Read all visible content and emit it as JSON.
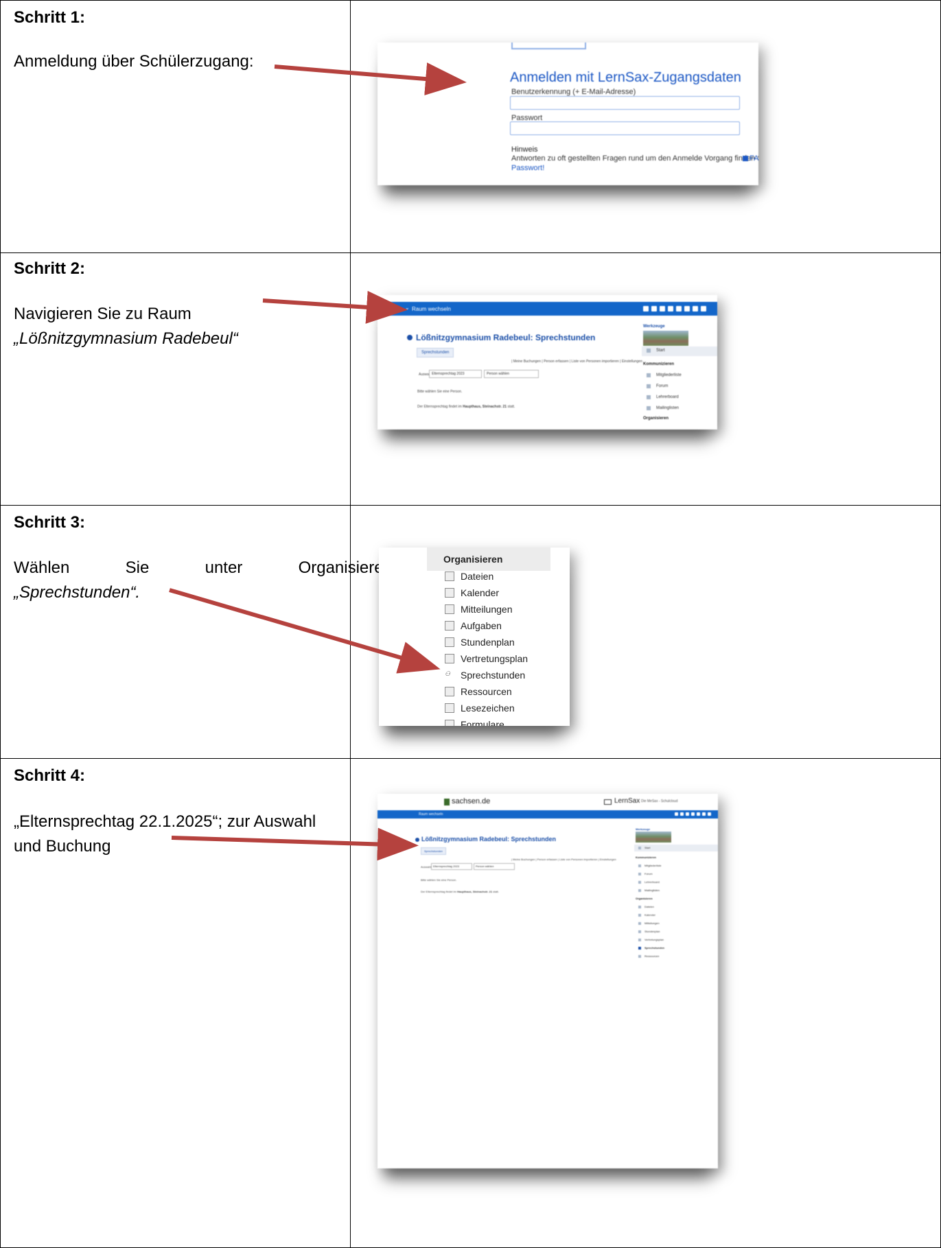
{
  "steps": [
    {
      "title": "Schritt 1:",
      "text": "Anmeldung über Schülerzugang:"
    },
    {
      "title": "Schritt 2:",
      "text_line1": "Navigieren Sie zu Raum",
      "text_line2": "„Lößnitzgymnasium Radebeul“"
    },
    {
      "title": "Schritt 3:",
      "word1": "Wählen",
      "word2": "Sie",
      "word3": "unter",
      "word4": "Organisieren",
      "text_line2": "„Sprechstunden“."
    },
    {
      "title": "Schritt 4:",
      "text_line1": "„Elternsprechtag 22.1.2025“; zur Auswahl",
      "text_line2": "und Buchung"
    }
  ],
  "shot1": {
    "heading": "Anmelden mit LernSax-Zugangsdaten",
    "user_label": "Benutzerkennung (+ E-Mail-Adresse)",
    "password_label": "Passwort",
    "hint_label": "Hinweis",
    "hint_text": "Antworten zu oft gestellten Fragen rund um den Anmelde Vorgang finden Sie in unseren",
    "hint_link": "FA",
    "forgot_link": "Passwort!"
  },
  "lernsax": {
    "room_switch": "Raum wechseln",
    "page_title": "Lößnitzgymnasium Radebeul: Sprechstunden",
    "tab": "Sprechstunden",
    "links": "| Meine Buchungen | Person erfassen | Liste von Personen importieren | Einstellungen",
    "auswahl_label": "Auswahl",
    "select_event": "Elternsprechtag 2023",
    "select_person": "Person wählen",
    "choose_person": "Bitte wählen Sie eine Person.",
    "location_pre": "Der Elternsprechtag findet im",
    "location_bold": "Haupthaus, Steinachstr. 21",
    "location_post": "statt.",
    "tools": "Werkzeuge",
    "start": "Start",
    "kommunizieren": "Kommunizieren",
    "mitglieder": "Mitgliederliste",
    "forum": "Forum",
    "lehrerboard": "Lehrerboard",
    "mailinglisten": "Mailinglisten",
    "organisieren": "Organisieren",
    "org_items": [
      "Dateien",
      "Kalender",
      "Mitteilungen",
      "Stundenplan",
      "Vertretungsplan",
      "Sprechstunden",
      "Ressourcen"
    ]
  },
  "shot3": {
    "heading": "Organisieren",
    "items": [
      "Dateien",
      "Kalender",
      "Mitteilungen",
      "Aufgaben",
      "Stundenplan",
      "Vertretungsplan",
      "Sprechstunden",
      "Ressourcen",
      "Lesezeichen",
      "Formulare"
    ]
  },
  "shot4": {
    "site": "sachsen.de",
    "brand": "LernSax",
    "brand_sub": "Die MeSax - Schulcloud"
  },
  "colors": {
    "arrow": "#b5423e",
    "lernsax_blue": "#1366c9"
  }
}
